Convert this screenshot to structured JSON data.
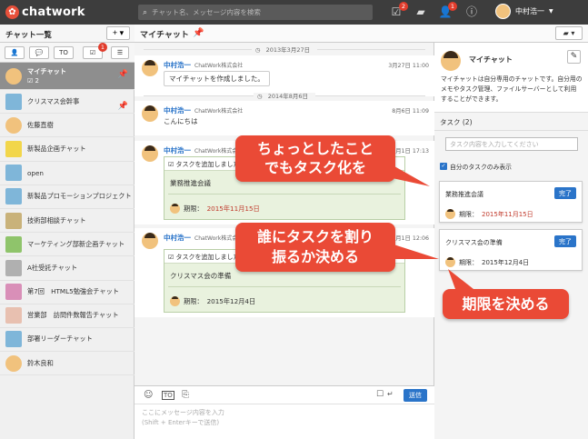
{
  "app": {
    "logo_text": "chatwork"
  },
  "search": {
    "placeholder": "チャット名、メッセージ内容を検索"
  },
  "topbar": {
    "task_badge": "2",
    "contact_badge": "1",
    "user_name": "中村浩一"
  },
  "sidebar": {
    "title": "チャット一覧",
    "add_label": "+ ▾",
    "filter_labels": [
      "👤",
      "💬",
      "TO",
      "☑",
      "☰"
    ],
    "task_badge": "1",
    "items": [
      {
        "name": "マイチャット",
        "task_count": "2"
      },
      {
        "name": "クリスマス会幹事"
      },
      {
        "name": "佐藤直樹"
      },
      {
        "name": "新製品企画チャット"
      },
      {
        "name": "open"
      },
      {
        "name": "新製品プロモーションプロジェクト"
      },
      {
        "name": "技術部相談チャット"
      },
      {
        "name": "マーケティング部新企画チャット"
      },
      {
        "name": "A社受託チャット"
      },
      {
        "name": "第7回　HTML5勉強会チャット"
      },
      {
        "name": "営業部　訪問件数報告チャット"
      },
      {
        "name": "部署リーダーチャット"
      },
      {
        "name": "鈴木良和"
      }
    ]
  },
  "chat": {
    "title": "マイチャット",
    "date1": "2013年3月27日",
    "date2": "2014年8月6日",
    "messages": [
      {
        "name": "中村浩一",
        "org": "ChatWork株式会社",
        "time": "3月27日 11:00",
        "text": "マイチャットを作成しました。"
      },
      {
        "name": "中村浩一",
        "org": "ChatWork株式会社",
        "time": "8月6日 11:09",
        "text": "こんにちは"
      },
      {
        "name": "中村浩一",
        "org": "ChatWork株式会社",
        "time": "11月1日 17:13",
        "task_head": "タスクを追加しました",
        "task_name": "業務推進会議",
        "due_label": "期限：",
        "due": "2015年11月15日"
      },
      {
        "name": "中村浩一",
        "org": "ChatWork株式会社",
        "time": "11月1日 12:06",
        "task_head": "タスクを追加しました",
        "task_name": "クリスマス会の準備",
        "due_label": "期限：",
        "due": "2015年12月4日"
      }
    ],
    "input_placeholder": "ここにメッセージ内容を入力\n(Shift + Enterキーで送信)",
    "send_label": "送信"
  },
  "right": {
    "room_title": "マイチャット",
    "description": "マイチャットは自分専用のチャットです。自分用のメモやタスク管理、ファイルサーバーとして利用することができます。",
    "task_heading": "タスク (2)",
    "task_input_placeholder": "タスク内容を入力してください",
    "my_tasks_label": "自分のタスクのみ表示",
    "tasks": [
      {
        "name": "業務推進会議",
        "done_label": "完了",
        "due_label": "期限：",
        "due": "2015年11月15日"
      },
      {
        "name": "クリスマス会の準備",
        "done_label": "完了",
        "due_label": "期限：",
        "due": "2015年12月4日"
      }
    ]
  },
  "callouts": {
    "c1_line1": "ちょっとしたこと",
    "c1_line2": "でもタスク化を",
    "c2_line1": "誰にタスクを割り",
    "c2_line2": "振るか決める",
    "c3": "期限を決める"
  },
  "colors": {
    "accent": "#2a74c9",
    "callout": "#ea4a36",
    "topbar": "#3d3d3d"
  }
}
